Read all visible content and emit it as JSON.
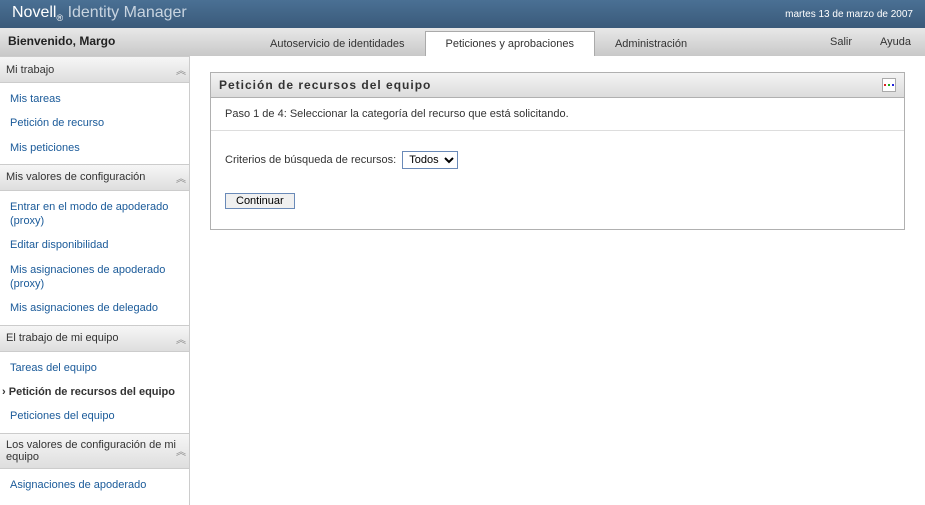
{
  "header": {
    "brand_main": "Novell",
    "brand_sub": "®",
    "brand_product": "Identity Manager",
    "date": "martes 13 de marzo de 2007"
  },
  "subheader": {
    "welcome": "Bienvenido, Margo"
  },
  "tabs": [
    {
      "label": "Autoservicio de identidades",
      "active": false
    },
    {
      "label": "Peticiones y aprobaciones",
      "active": true
    },
    {
      "label": "Administración",
      "active": false
    }
  ],
  "topLinks": {
    "logout": "Salir",
    "help": "Ayuda"
  },
  "sidebar": [
    {
      "title": "Mi trabajo",
      "items": [
        {
          "label": "Mis tareas",
          "active": false
        },
        {
          "label": "Petición de recurso",
          "active": false
        },
        {
          "label": "Mis peticiones",
          "active": false
        }
      ]
    },
    {
      "title": "Mis valores de configuración",
      "items": [
        {
          "label": "Entrar en el modo de apoderado (proxy)",
          "active": false
        },
        {
          "label": "Editar disponibilidad",
          "active": false
        },
        {
          "label": "Mis asignaciones de apoderado (proxy)",
          "active": false
        },
        {
          "label": "Mis asignaciones de delegado",
          "active": false
        }
      ]
    },
    {
      "title": "El trabajo de mi equipo",
      "items": [
        {
          "label": "Tareas del equipo",
          "active": false
        },
        {
          "label": "Petición de recursos del equipo",
          "active": true
        },
        {
          "label": "Peticiones del equipo",
          "active": false
        }
      ]
    },
    {
      "title": "Los valores de configuración de mi equipo",
      "items": [
        {
          "label": "Asignaciones de apoderado",
          "active": false
        }
      ]
    }
  ],
  "panel": {
    "title": "Petición de recursos del equipo",
    "step": "Paso 1 de 4: Seleccionar la categoría del recurso que está solicitando.",
    "criteria_label": "Criterios de búsqueda de recursos:",
    "dropdown_value": "Todos",
    "continue_label": "Continuar"
  }
}
